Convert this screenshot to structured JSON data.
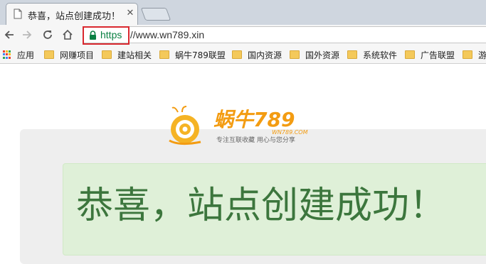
{
  "tab": {
    "title": "恭喜，站点创建成功！"
  },
  "toolbar": {
    "url_scheme": "https",
    "url_rest": "://www.wn789.xin"
  },
  "bookmarks": {
    "apps_label": "应用",
    "items": [
      {
        "label": "网赚项目"
      },
      {
        "label": "建站相关"
      },
      {
        "label": "蜗牛789联盟"
      },
      {
        "label": "国内资源"
      },
      {
        "label": "国外资源"
      },
      {
        "label": "系统软件"
      },
      {
        "label": "广告联盟"
      },
      {
        "label": "游"
      }
    ]
  },
  "page": {
    "logo_title": "蜗牛789",
    "logo_domain": "WN789.COM",
    "logo_slogan": "专注互联收藏  用心与您分享",
    "heading": "恭喜，站点创建成功！"
  },
  "colors": {
    "alert_bg": "#dff0d8",
    "alert_text": "#3c763d",
    "url_secure": "#0b8043",
    "highlight_border": "#d9282f",
    "logo_orange": "#f39c12"
  }
}
